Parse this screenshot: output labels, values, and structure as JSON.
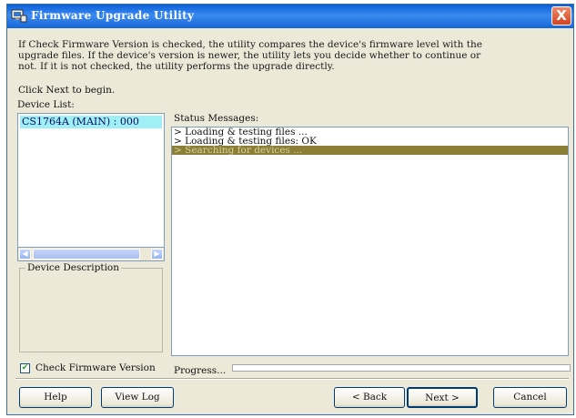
{
  "window": {
    "title": "Firmware Upgrade Utility",
    "close_label": "X"
  },
  "intro": {
    "text": "If Check Firmware Version is checked, the utility compares the device's firmware level with the upgrade files. If the device's version is newer, the utility lets you decide whether to continue or not. If it is not checked, the utility performs the upgrade directly.",
    "click_next": "Click Next to begin."
  },
  "device_list": {
    "label": "Device List:",
    "items": [
      "CS1764A (MAIN) : 000"
    ]
  },
  "device_description": {
    "label": "Device Description"
  },
  "status": {
    "label": "Status Messages:",
    "messages": [
      "> Loading & testing files ...",
      "> Loading & testing files: OK",
      "> Searching for devices ..."
    ]
  },
  "options": {
    "check_firmware_label": "Check Firmware Version",
    "check_firmware_checked": true
  },
  "progress": {
    "label": "Progress...",
    "value": 0
  },
  "buttons": {
    "help": "Help",
    "view_log": "View Log",
    "back": "< Back",
    "next": "Next >",
    "cancel": "Cancel"
  },
  "colors": {
    "titlebar": "#0a5fd8",
    "device_selected": "#9ff0f6",
    "status_selected": "#8c7e36",
    "window_bg": "#ece9d8"
  }
}
